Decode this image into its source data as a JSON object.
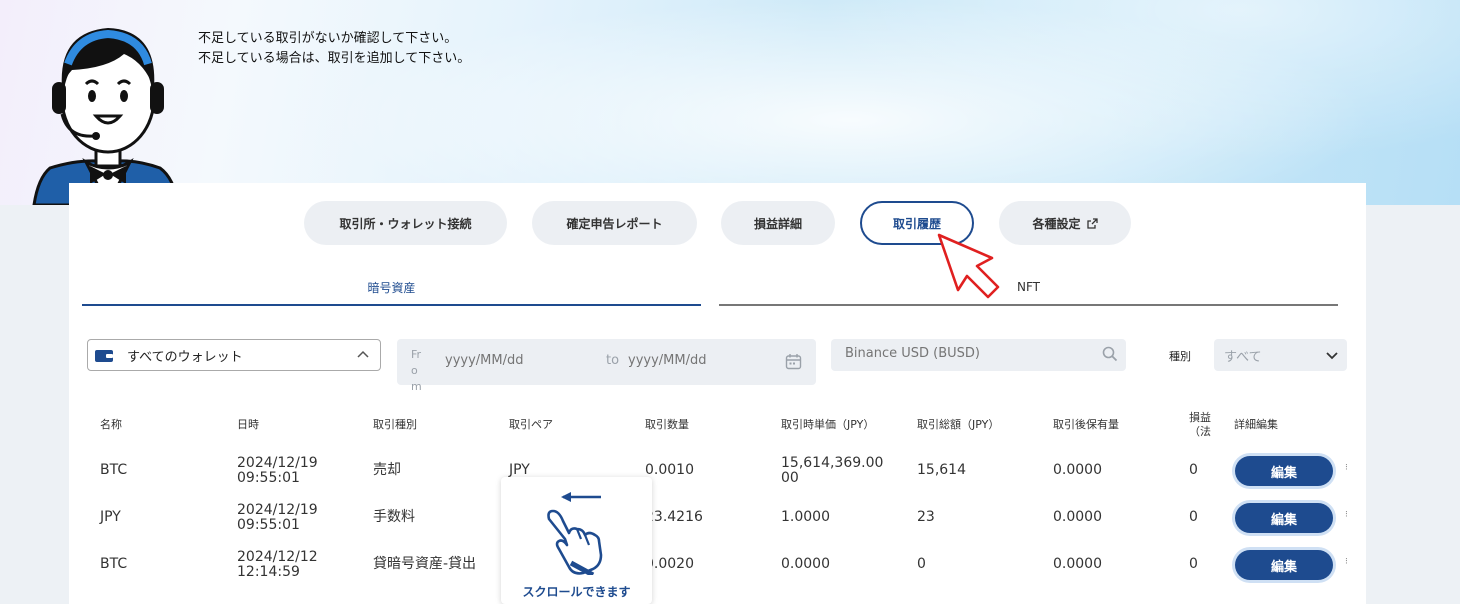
{
  "banner": {
    "line1": "不足している取引がないか確認して下さい。",
    "line2": "不足している場合は、取引を追加して下さい。"
  },
  "nav_tabs": [
    {
      "label": "取引所・ウォレット接続",
      "active": false
    },
    {
      "label": "確定申告レポート",
      "active": false
    },
    {
      "label": "損益詳細",
      "active": false
    },
    {
      "label": "取引履歴",
      "active": true
    },
    {
      "label": "各種設定",
      "active": false,
      "icon": "external-link-icon"
    }
  ],
  "sub_tabs": [
    {
      "label": "暗号資産",
      "active": true
    },
    {
      "label": "NFT",
      "active": false
    }
  ],
  "filters": {
    "wallet": "すべてのウォレット",
    "date_from_label": "From",
    "date_from_placeholder": "yyyy/MM/dd",
    "date_to_label": "to",
    "date_to_placeholder": "yyyy/MM/dd",
    "search_placeholder": "Binance USD (BUSD)",
    "type_label": "種別",
    "type_value": "すべて"
  },
  "table": {
    "headers": [
      "名称",
      "日時",
      "取引種別",
      "取引ペア",
      "取引数量",
      "取引時単価（JPY）",
      "取引総額（JPY）",
      "取引後保有量",
      "損益（法",
      "詳細編集"
    ],
    "rows": [
      {
        "name": "BTC",
        "date": "2024/12/19",
        "time": "09:55:01",
        "type": "売却",
        "pair": "JPY",
        "qty": "0.0010",
        "unit_price_1": "15,614,369.00",
        "unit_price_2": "00",
        "total": "15,614",
        "holding": "0.0000",
        "pl": "0",
        "edit": "編集"
      },
      {
        "name": "JPY",
        "date": "2024/12/19",
        "time": "09:55:01",
        "type": "手数料",
        "pair": "",
        "qty": "23.4216",
        "unit_price_1": "1.0000",
        "unit_price_2": "",
        "total": "23",
        "holding": "0.0000",
        "pl": "0",
        "edit": "編集"
      },
      {
        "name": "BTC",
        "date": "2024/12/12",
        "time": "12:14:59",
        "type": "貸暗号資産-貸出",
        "pair": "",
        "qty": "0.0020",
        "unit_price_1": "0.0000",
        "unit_price_2": "",
        "total": "0",
        "holding": "0.0000",
        "pl": "0",
        "edit": "編集"
      }
    ]
  },
  "scroll_hint": "スクロールできます",
  "colors": {
    "primary": "#1e4b8f",
    "pointer": "#e02020"
  }
}
